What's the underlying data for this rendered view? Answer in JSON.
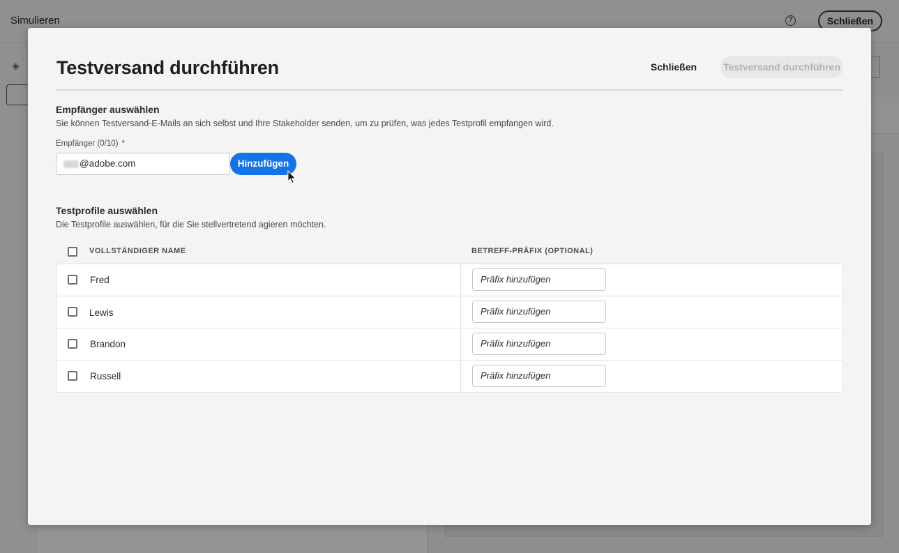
{
  "background": {
    "title": "Simulieren",
    "help_icon": "help-icon",
    "close_label": "Schließen"
  },
  "dialog": {
    "title": "Testversand durchführen",
    "close_label": "Schließen",
    "primary_label": "Testversand durchführen",
    "recipients": {
      "heading": "Empfänger auswählen",
      "description": "Sie können Testversand-E-Mails an sich selbst und Ihre Stakeholder senden, um zu prüfen, was jedes Testprofil empfangen wird.",
      "field_label": "Empfänger (0/10)",
      "required_marker": "*",
      "email_value": "@adobe.com",
      "add_label": "Hinzufügen"
    },
    "profiles": {
      "heading": "Testprofile auswählen",
      "description": "Die Testprofile auswählen, für die Sie stellvertretend agieren möchten.",
      "columns": [
        "VOLLSTÄNDIGER NAME",
        "BETREFF-PRÄFIX (OPTIONAL)"
      ],
      "rows": [
        {
          "name": "Fred",
          "prefix_placeholder": "Präfix hinzufügen"
        },
        {
          "name": "Lewis",
          "prefix_placeholder": "Präfix hinzufügen"
        },
        {
          "name": "Brandon",
          "prefix_placeholder": "Präfix hinzufügen"
        },
        {
          "name": "Russell",
          "prefix_placeholder": "Präfix hinzufügen"
        }
      ]
    }
  },
  "colors": {
    "accent": "#1473e6",
    "disabled_bg": "#e8e8e8",
    "disabled_text": "#b1b1b1"
  }
}
